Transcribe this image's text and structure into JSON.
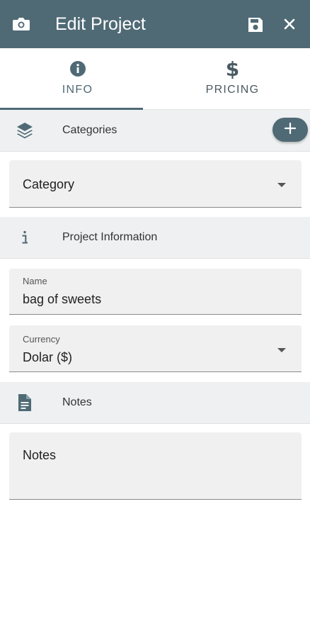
{
  "appbar": {
    "title": "Edit Project",
    "icons": [
      "camera-icon",
      "save-icon",
      "close-icon"
    ]
  },
  "tabs": [
    {
      "label": "INFO",
      "icon": "info-icon",
      "selected": true
    },
    {
      "label": "PRICING",
      "icon": "dollar-icon",
      "icon_text": "$",
      "selected": false
    }
  ],
  "sections": {
    "categories": {
      "label": "Categories",
      "icon": "layers-icon"
    },
    "project_information": {
      "label": "Project Information",
      "icon": "info-letter-icon",
      "icon_text": "i"
    },
    "notes": {
      "label": "Notes",
      "icon": "document-icon"
    }
  },
  "fields": {
    "category": {
      "value": "Category"
    },
    "name": {
      "label": "Name",
      "value": "bag of sweets"
    },
    "currency": {
      "label": "Currency",
      "value": "Dolar ($)"
    },
    "notes": {
      "value": "Notes"
    }
  },
  "colors": {
    "primary": "#4f6a75",
    "section_bg": "#eef0f1",
    "field_bg": "#f0f0f0"
  }
}
